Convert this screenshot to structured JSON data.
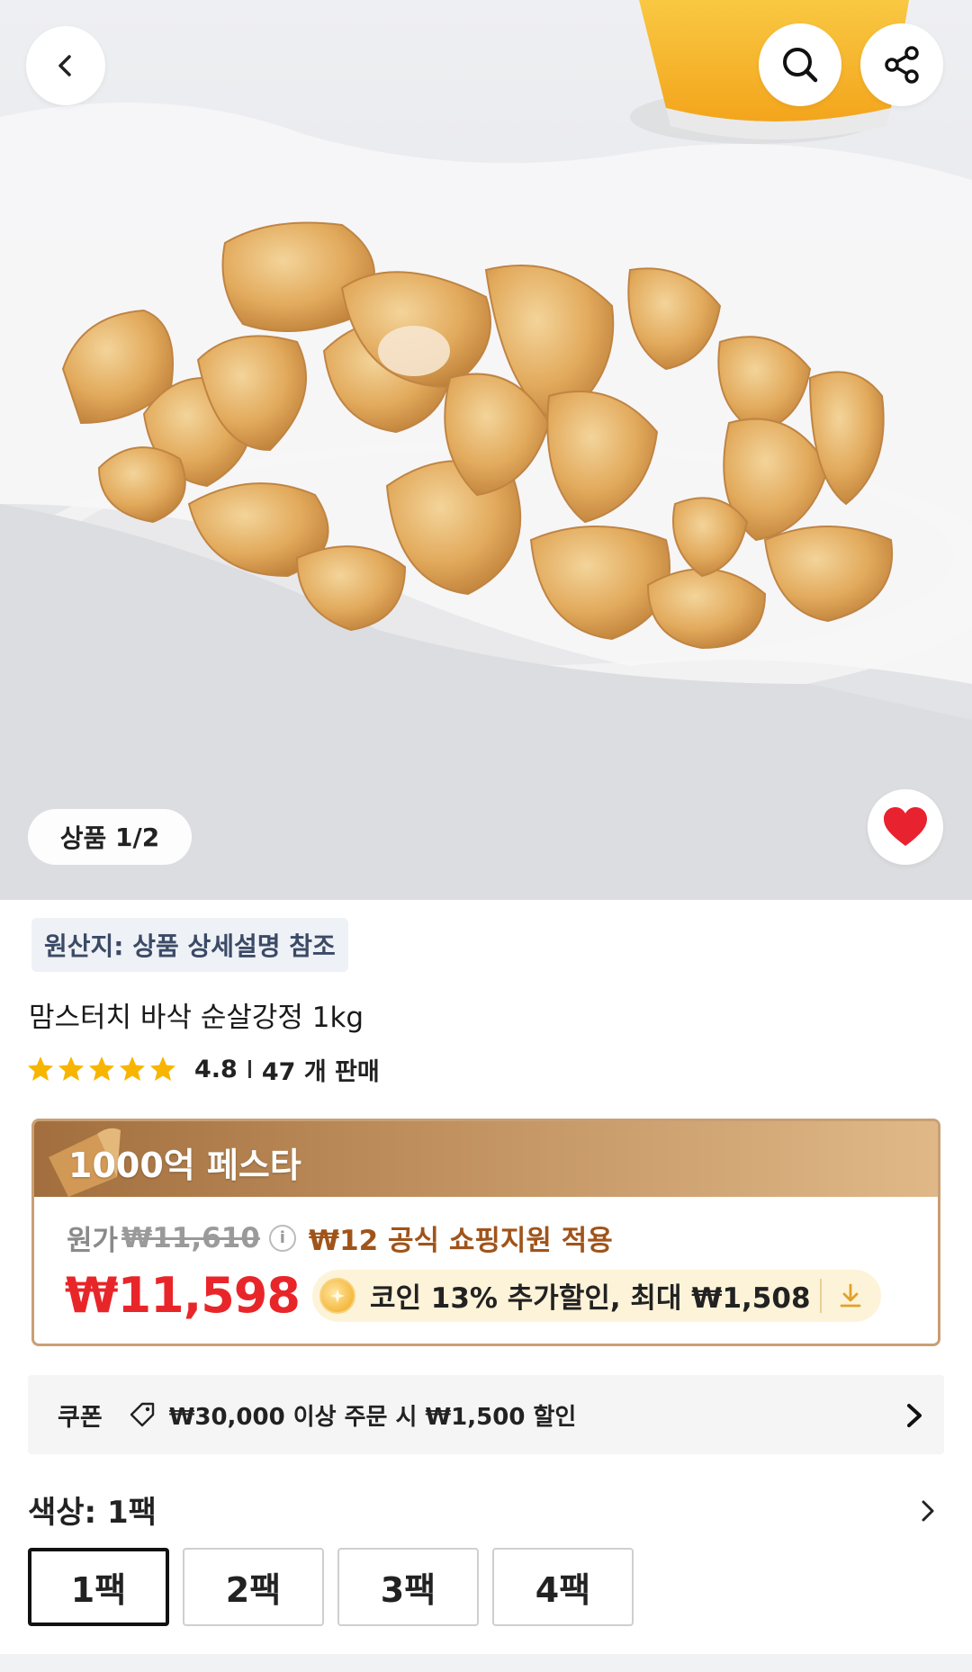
{
  "hero": {
    "counter_label": "상품",
    "counter_value": "1/2"
  },
  "product": {
    "origin": "원산지: 상품 상세설명 참조",
    "title": "맘스터치 바삭 순살강정 1kg",
    "rating": "4.8",
    "sold": "47 개 판매"
  },
  "festa": {
    "title": "1000억 페스타",
    "original_label": "원가",
    "original_price": "₩11,610",
    "support_text": "₩12 공식 쇼핑지원 적용",
    "price": "₩11,598",
    "coin_text": "코인 13% 추가할인, 최대 ₩1,508"
  },
  "coupon": {
    "label": "쿠폰",
    "text": "₩30,000 이상 주문 시 ₩1,500 할인"
  },
  "options": {
    "title": "색상: 1팩",
    "items": [
      "1팩",
      "2팩",
      "3팩",
      "4팩"
    ],
    "selected": "1팩"
  },
  "colors": {
    "price_red": "#e8262a",
    "festa_gold": "#b98656",
    "heart_red": "#e8222e",
    "star_yellow": "#f7b500"
  },
  "icons": [
    "back-icon",
    "search-icon",
    "share-icon",
    "heart-icon",
    "star-icon",
    "info-icon",
    "coin-icon",
    "download-icon",
    "tag-icon",
    "chevron-right-icon"
  ]
}
